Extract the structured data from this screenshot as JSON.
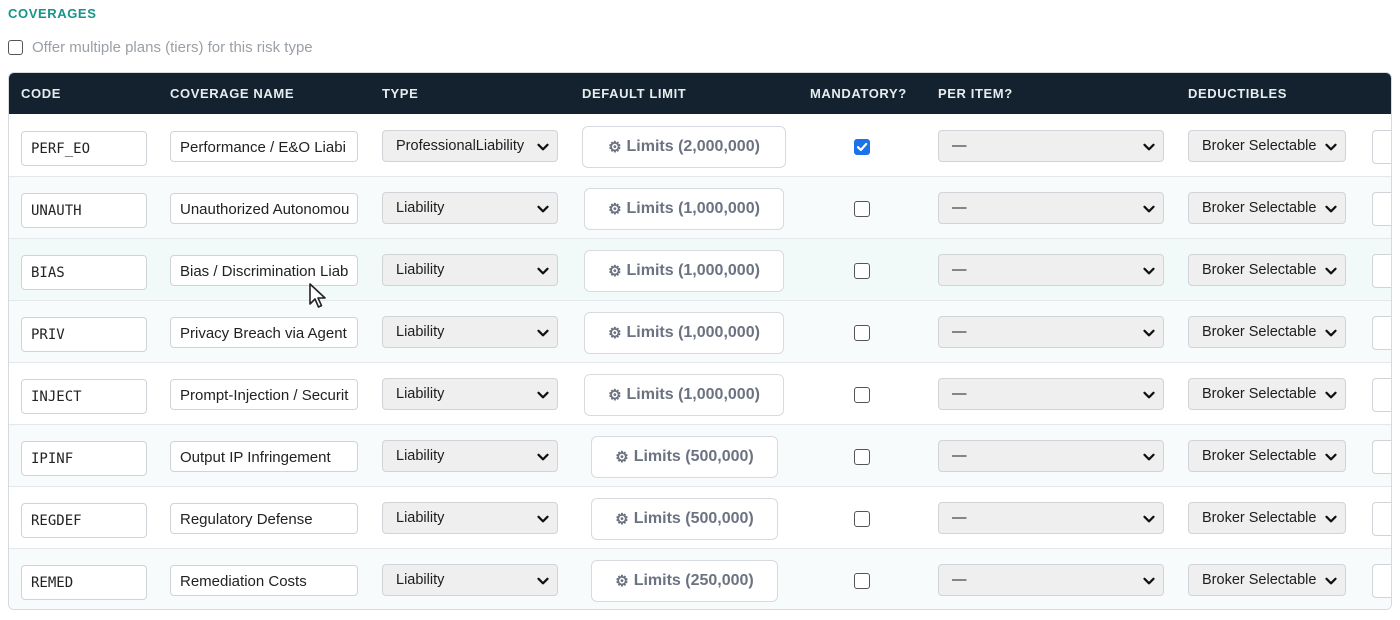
{
  "section": {
    "title": "COVERAGES"
  },
  "tiers_option": {
    "label": "Offer multiple plans (tiers) for this risk type",
    "checked": false
  },
  "columns": {
    "code": "CODE",
    "name": "COVERAGE NAME",
    "type": "TYPE",
    "limit": "DEFAULT LIMIT",
    "mandatory": "MANDATORY?",
    "per_item": "PER ITEM?",
    "deductibles": "DEDUCTIBLES"
  },
  "rows": [
    {
      "code": "PERF_EO",
      "name": "Performance / E&O Liabi",
      "type": "ProfessionalLiability",
      "limit": "Limits (2,000,000)",
      "mandatory": true,
      "per_item": "—",
      "deductibles": "Broker Selectable"
    },
    {
      "code": "UNAUTH",
      "name": "Unauthorized Autonomou",
      "type": "Liability",
      "limit": "Limits (1,000,000)",
      "mandatory": false,
      "per_item": "—",
      "deductibles": "Broker Selectable"
    },
    {
      "code": "BIAS",
      "name": "Bias / Discrimination Liab",
      "type": "Liability",
      "limit": "Limits (1,000,000)",
      "mandatory": false,
      "per_item": "—",
      "deductibles": "Broker Selectable"
    },
    {
      "code": "PRIV",
      "name": "Privacy Breach via Agent",
      "type": "Liability",
      "limit": "Limits (1,000,000)",
      "mandatory": false,
      "per_item": "—",
      "deductibles": "Broker Selectable"
    },
    {
      "code": "INJECT",
      "name": "Prompt-Injection / Securit",
      "type": "Liability",
      "limit": "Limits (1,000,000)",
      "mandatory": false,
      "per_item": "—",
      "deductibles": "Broker Selectable"
    },
    {
      "code": "IPINF",
      "name": "Output IP Infringement",
      "type": "Liability",
      "limit": "Limits (500,000)",
      "mandatory": false,
      "per_item": "—",
      "deductibles": "Broker Selectable"
    },
    {
      "code": "REGDEF",
      "name": "Regulatory Defense",
      "type": "Liability",
      "limit": "Limits (500,000)",
      "mandatory": false,
      "per_item": "—",
      "deductibles": "Broker Selectable"
    },
    {
      "code": "REMED",
      "name": "Remediation Costs",
      "type": "Liability",
      "limit": "Limits (250,000)",
      "mandatory": false,
      "per_item": "—",
      "deductibles": "Broker Selectable"
    }
  ],
  "icons": {
    "limit_button": "gear-icon",
    "select": "chevron-down-icon",
    "pointer": "mouse-cursor-icon"
  },
  "colors": {
    "header_bg": "#13222e",
    "accent": "#14958a",
    "checkbox_on": "#1a73e8"
  }
}
